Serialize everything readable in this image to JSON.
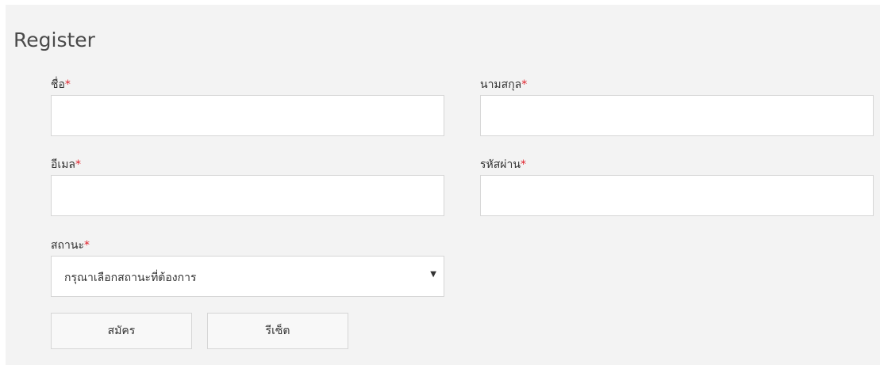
{
  "form": {
    "title": "Register",
    "required_marker": "*",
    "fields": {
      "first_name": {
        "label": "ชื่อ",
        "value": "",
        "placeholder": ""
      },
      "last_name": {
        "label": "นามสกุล",
        "value": "",
        "placeholder": ""
      },
      "email": {
        "label": "อีเมล",
        "value": "",
        "placeholder": ""
      },
      "password": {
        "label": "รหัสผ่าน",
        "value": "",
        "placeholder": ""
      },
      "status": {
        "label": "สถานะ",
        "selected": "กรุณาเลือกสถานะที่ต้องการ",
        "caret": "▼"
      }
    },
    "buttons": {
      "submit": "สมัคร",
      "reset": "รีเซ็ต"
    }
  },
  "colors": {
    "panel_bg": "#f3f3f3",
    "required": "#e0202a",
    "border": "#d6d6d6"
  }
}
